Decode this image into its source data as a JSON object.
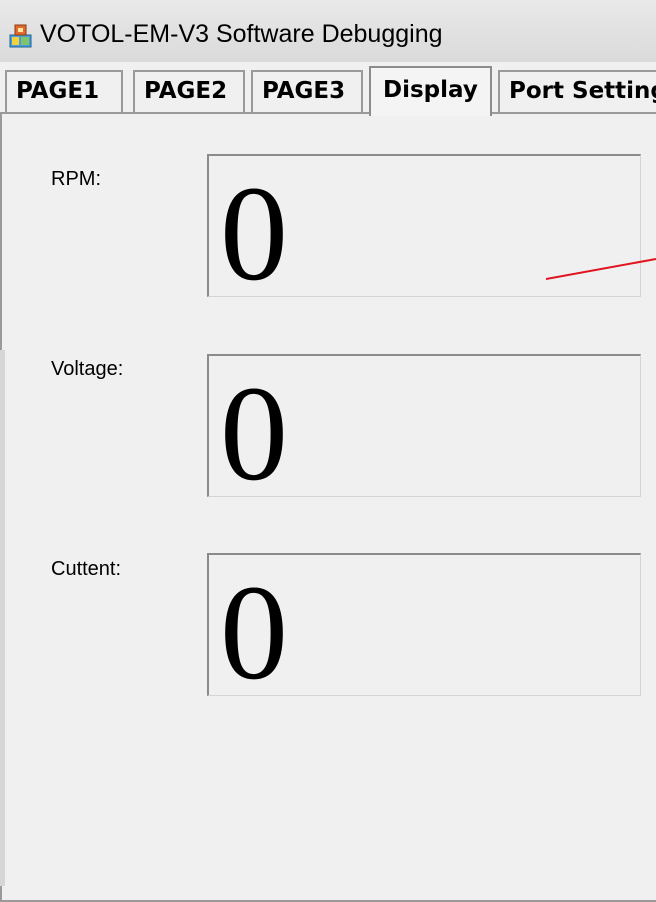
{
  "window": {
    "title": "VOTOL-EM-V3 Software Debugging",
    "icon": "app-icon"
  },
  "tabs": [
    {
      "label": "PAGE1",
      "active": false
    },
    {
      "label": "PAGE2",
      "active": false
    },
    {
      "label": "PAGE3",
      "active": false
    },
    {
      "label": "Display",
      "active": true
    },
    {
      "label": "Port Setting",
      "active": false
    }
  ],
  "display": {
    "rpm": {
      "label": "RPM:",
      "value": "0"
    },
    "voltage": {
      "label": "Voltage:",
      "value": "0"
    },
    "current": {
      "label": "Cuttent:",
      "value": "0"
    }
  },
  "colors": {
    "background": "#f0f0f0",
    "tab_border": "#9a9a9a",
    "annotation_line": "#e0141e"
  }
}
